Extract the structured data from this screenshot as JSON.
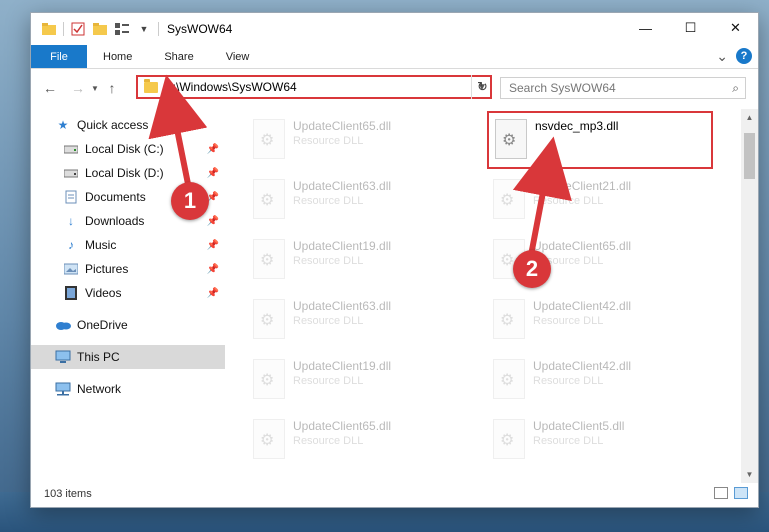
{
  "window": {
    "title": "SysWOW64",
    "controls": {
      "minimize": "—",
      "maximize": "☐",
      "close": "✕"
    }
  },
  "ribbon": {
    "tabs": [
      "File",
      "Home",
      "Share",
      "View"
    ],
    "chevron": "⌄",
    "help": "?"
  },
  "address": {
    "path": "C:\\Windows\\SysWOW64",
    "search_placeholder": "Search SysWOW64"
  },
  "sidebar": {
    "quick_access": "Quick access",
    "items": [
      {
        "label": "Local Disk (C:)",
        "icon": "drive-icon"
      },
      {
        "label": "Local Disk (D:)",
        "icon": "drive-icon"
      },
      {
        "label": "Documents",
        "icon": "documents-icon"
      },
      {
        "label": "Downloads",
        "icon": "downloads-icon"
      },
      {
        "label": "Music",
        "icon": "music-icon"
      },
      {
        "label": "Pictures",
        "icon": "pictures-icon"
      },
      {
        "label": "Videos",
        "icon": "videos-icon"
      }
    ],
    "onedrive": "OneDrive",
    "this_pc": "This PC",
    "network": "Network"
  },
  "files": [
    {
      "name": "UpdateClient65.dll",
      "type": "Resource DLL"
    },
    {
      "name": "nsvdec_mp3.dll",
      "type": ""
    },
    {
      "name": "UpdateClient63.dll",
      "type": "Resource DLL"
    },
    {
      "name": "UpdateClient21.dll",
      "type": "Resource DLL"
    },
    {
      "name": "UpdateClient19.dll",
      "type": "Resource DLL"
    },
    {
      "name": "UpdateClient65.dll",
      "type": "Resource DLL"
    },
    {
      "name": "UpdateClient63.dll",
      "type": "Resource DLL"
    },
    {
      "name": "UpdateClient42.dll",
      "type": "Resource DLL"
    },
    {
      "name": "UpdateClient19.dll",
      "type": "Resource DLL"
    },
    {
      "name": "UpdateClient42.dll",
      "type": "Resource DLL"
    },
    {
      "name": "UpdateClient65.dll",
      "type": "Resource DLL"
    },
    {
      "name": "UpdateClient5.dll",
      "type": "Resource DLL"
    }
  ],
  "status": {
    "items": "103 items"
  },
  "annotations": {
    "step1": "1",
    "step2": "2",
    "color": "#d9373a"
  }
}
